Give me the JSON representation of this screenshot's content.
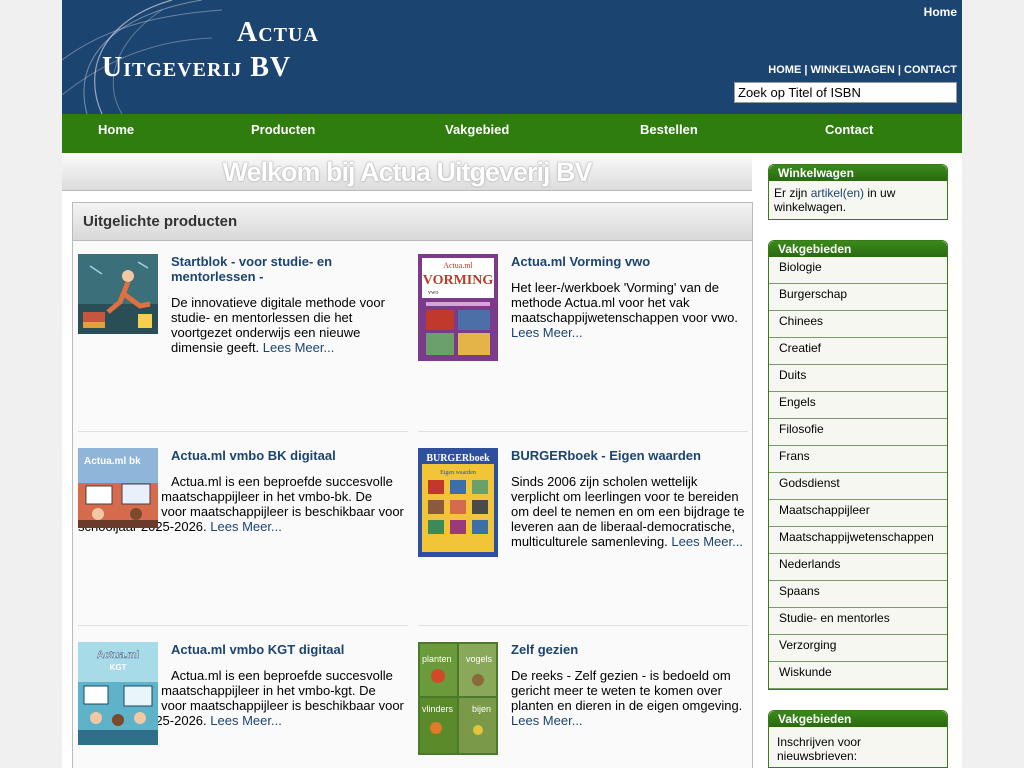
{
  "header": {
    "logo_line1": "Actua",
    "logo_line2": "Uitgeverij BV",
    "home_link": "Home",
    "top_links": [
      "HOME",
      "WINKELWAGEN",
      "CONTACT"
    ],
    "search_placeholder": "Zoek op Titel of ISBN"
  },
  "nav": [
    "Home",
    "Producten",
    "Vakgebied",
    "Bestellen",
    "Contact"
  ],
  "welcome_title": "Welkom bij Actua Uitgeverij BV",
  "featured": {
    "heading": "Uitgelichte producten",
    "read_more": "Lees Meer...",
    "products": [
      {
        "title": "Startblok - voor studie- en mentorlessen -",
        "text": "De innovatieve digitale methode voor studie- en mentorlessen die het voortgezet onderwijs een nieuwe dimensie geeft."
      },
      {
        "title": "Actua.ml Vorming vwo",
        "text": "Het leer-/werkboek 'Vorming' van de methode Actua.ml voor het vak maatschappijwetenschappen voor vwo."
      },
      {
        "title": "Actua.ml vmbo BK digitaal",
        "text": "Actua.ml is een beproefde succesvolle methode voor maatschappijleer in het vmbo-bk. De digitale versie voor maatschappijleer is beschikbaar voor schooljaar 2025-2026."
      },
      {
        "title": "BURGERboek - Eigen waarden",
        "text": "Sinds 2006 zijn scholen wettelijk verplicht om leerlingen voor te bereiden om deel te nemen en om een bijdrage te leveren aan de liberaal-democratische, multiculturele samenleving."
      },
      {
        "title": "Actua.ml vmbo KGT digitaal",
        "text": "Actua.ml is een beproefde succesvolle methode voor maatschappijleer in het vmbo-kgt. De digitale versie voor maatschappijleer is beschikbaar voor schooljaar 2025-2026."
      },
      {
        "title": "Zelf gezien",
        "text": "De reeks - Zelf gezien - is bedoeld om gericht meer te weten te komen over planten en dieren in de eigen omgeving."
      }
    ],
    "covers": {
      "vorming_small": "Actua.ml",
      "vorming_big": "VORMING",
      "vorming_sub": "vwo",
      "burger_title": "BURGERboek",
      "burger_sub": "Eigen waarden",
      "bk_label": "Actua.ml bk",
      "kgt_label1": "Actua.ml",
      "kgt_label2": "KGT",
      "zelf_words": [
        "planten",
        "vogels",
        "vlinders",
        "bijen"
      ]
    }
  },
  "sidebar": {
    "cart": {
      "title": "Winkelwagen",
      "text_before": "Er zijn ",
      "link": "artikel(en)",
      "text_after": " in uw winkelwagen."
    },
    "subjects": {
      "title": "Vakgebieden",
      "items": [
        "Biologie",
        "Burgerschap",
        "Chinees",
        "Creatief",
        "Duits",
        "Engels",
        "Filosofie",
        "Frans",
        "Godsdienst",
        "Maatschappijleer",
        "Maatschappijwetenschappen",
        "Nederlands",
        "Spaans",
        "Studie- en mentorles",
        "Verzorging",
        "Wiskunde"
      ]
    },
    "newsletter": {
      "title": "Vakgebieden",
      "text": "Inschrijven voor nieuwsbrieven:"
    }
  },
  "colors": {
    "header": "#1c4470",
    "nav": "#2e7d0e",
    "link": "#1c4470",
    "sidebar_header": "#2e7d0e"
  }
}
